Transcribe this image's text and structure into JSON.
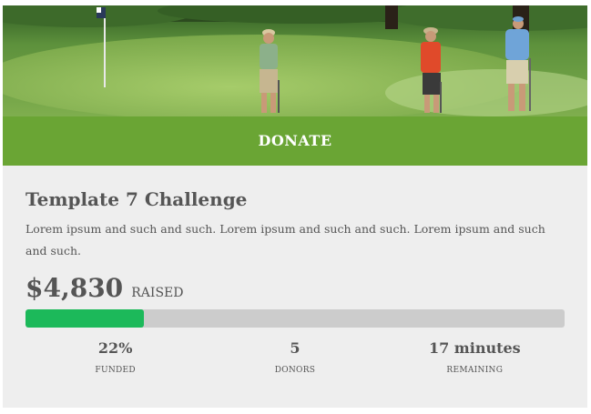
{
  "hero": {
    "image_description_icon": "golf-course-photo"
  },
  "donate": {
    "label": "DONATE",
    "color": "#6aa534"
  },
  "campaign": {
    "title": "Template 7 Challenge",
    "description": "Lorem ipsum and such and such. Lorem ipsum and such and such. Lorem ipsum and such and such.",
    "raised_amount": "$4,830",
    "raised_label": "RAISED",
    "progress_fraction": 0.22,
    "progress_color": "#1cb95a"
  },
  "stats": [
    {
      "value": "22%",
      "label": "FUNDED"
    },
    {
      "value": "5",
      "label": "DONORS"
    },
    {
      "value": "17 minutes",
      "label": "REMAINING"
    }
  ]
}
